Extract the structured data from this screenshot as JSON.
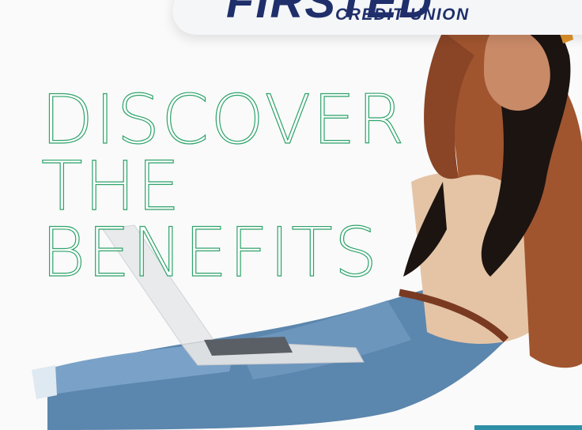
{
  "logo": {
    "wordmark": "FIRSTED",
    "subtitle": "CREDIT UNION",
    "color": "#1f2f6b"
  },
  "headline": {
    "lines": [
      "DISCOVER",
      "THE",
      "BENEFITS"
    ],
    "color": "#2ea36a"
  },
  "image": {
    "subject": "woman-relaxing-with-laptop-icon"
  }
}
